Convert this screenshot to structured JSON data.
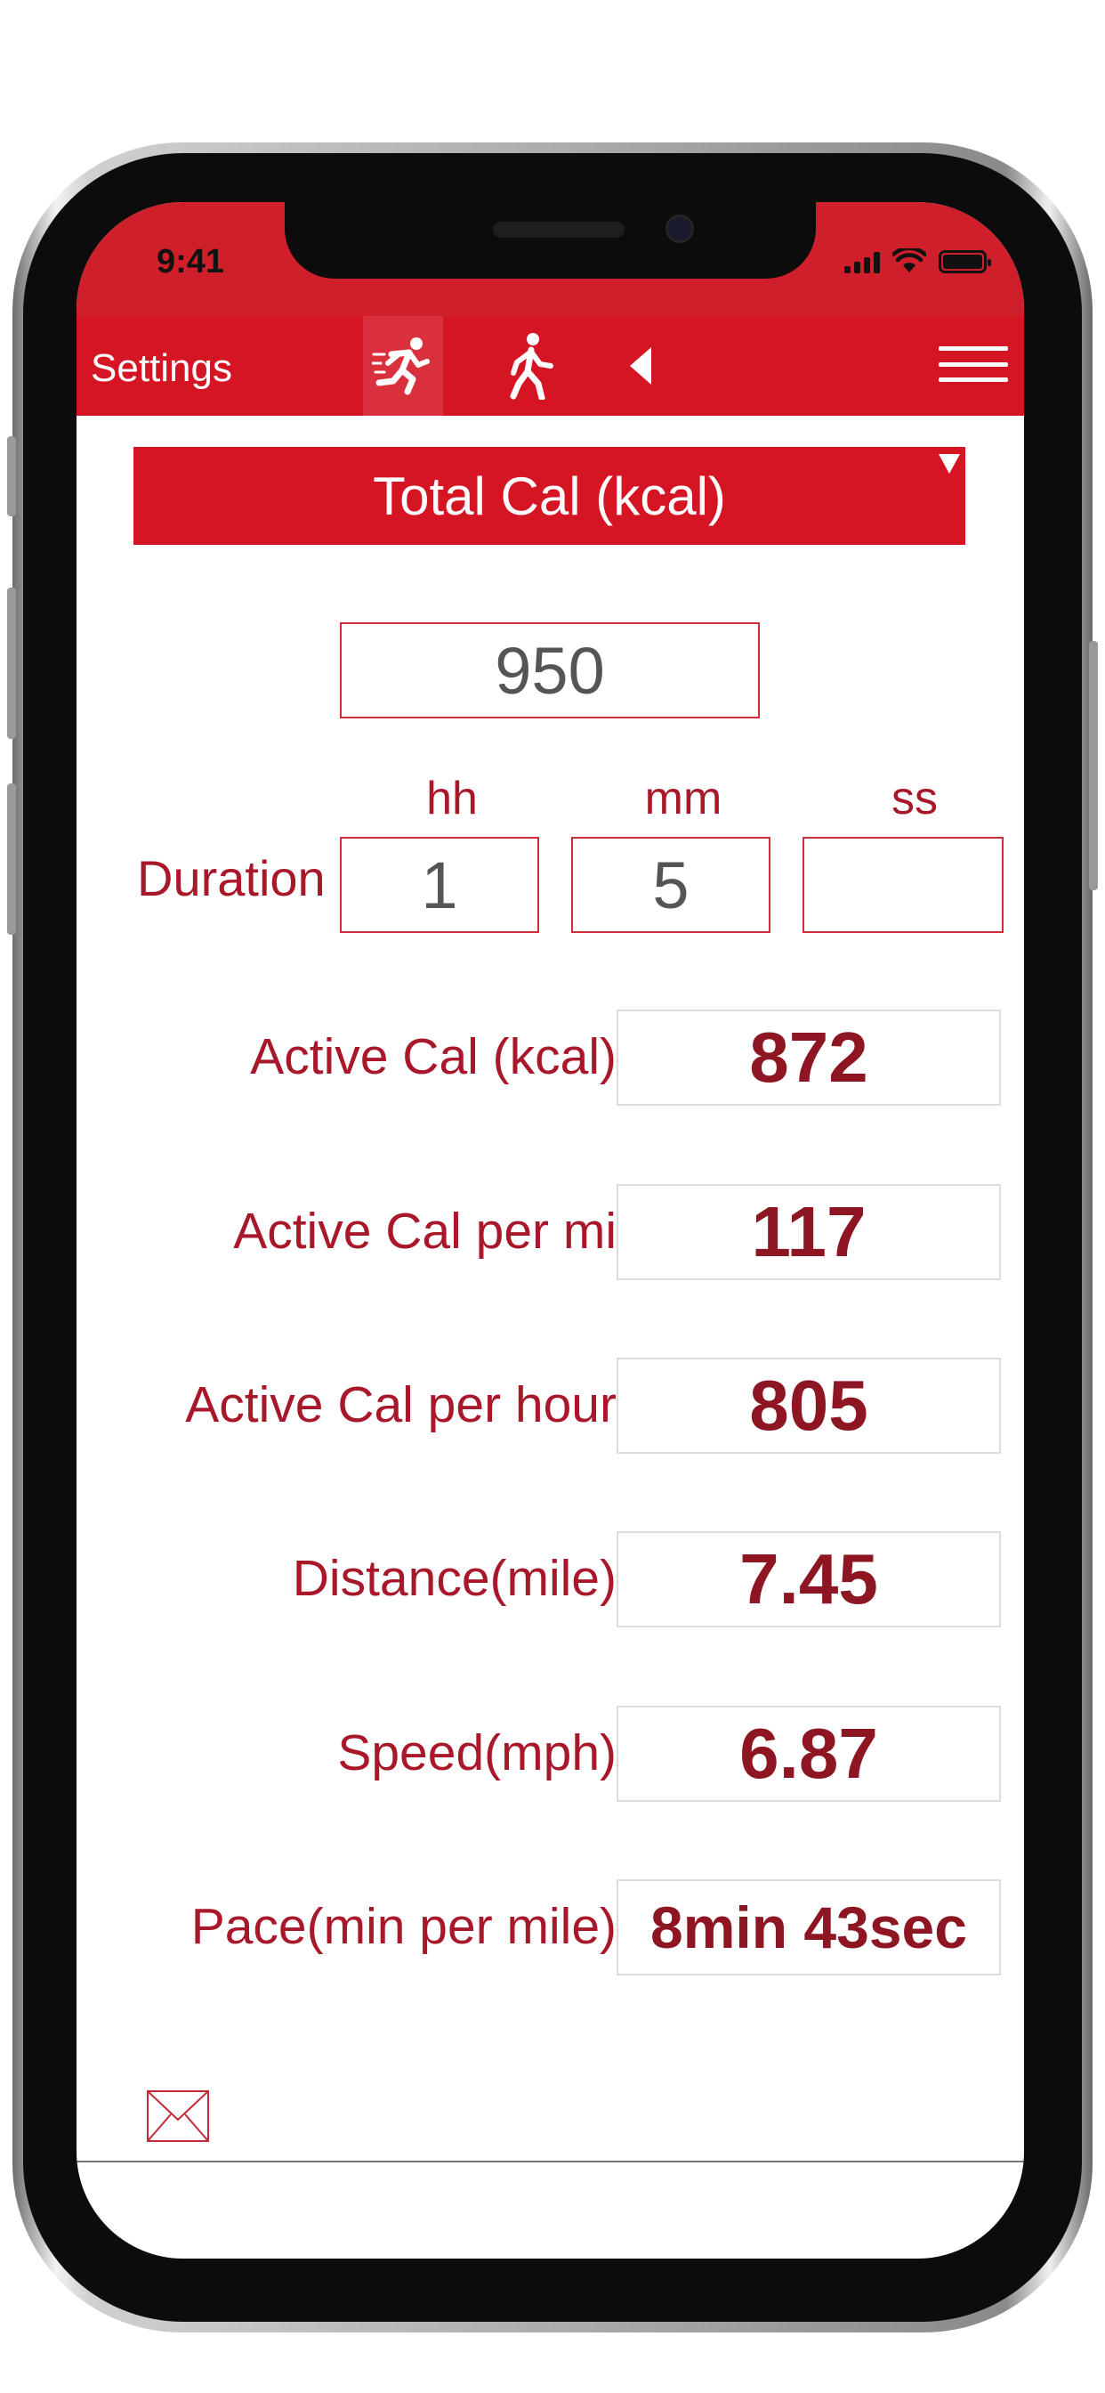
{
  "status_bar": {
    "time": "9:41"
  },
  "toolbar": {
    "settings_label": "Settings"
  },
  "dropdown": {
    "selected": "Total Cal (kcal)"
  },
  "total_input": {
    "value": "950"
  },
  "duration": {
    "label": "Duration",
    "hh_label": "hh",
    "mm_label": "mm",
    "ss_label": "ss",
    "hh_value": "1",
    "mm_value": "5",
    "ss_value": ""
  },
  "results": [
    {
      "label": "Active Cal (kcal)",
      "value": "872"
    },
    {
      "label": "Active Cal per mi",
      "value": "117"
    },
    {
      "label": "Active Cal per hour",
      "value": "805"
    },
    {
      "label": "Distance(mile)",
      "value": "7.45"
    },
    {
      "label": "Speed(mph)",
      "value": "6.87"
    },
    {
      "label": "Pace(min per mile)",
      "value": "8min 43sec"
    }
  ],
  "icons": {
    "run": "running-person-icon",
    "walk": "walking-person-icon",
    "back": "triangle-left-icon",
    "menu": "hamburger-menu-icon",
    "mail": "envelope-icon"
  },
  "colors": {
    "accent": "#d51424",
    "text_red": "#a8182a",
    "value_red": "#8e1622"
  }
}
